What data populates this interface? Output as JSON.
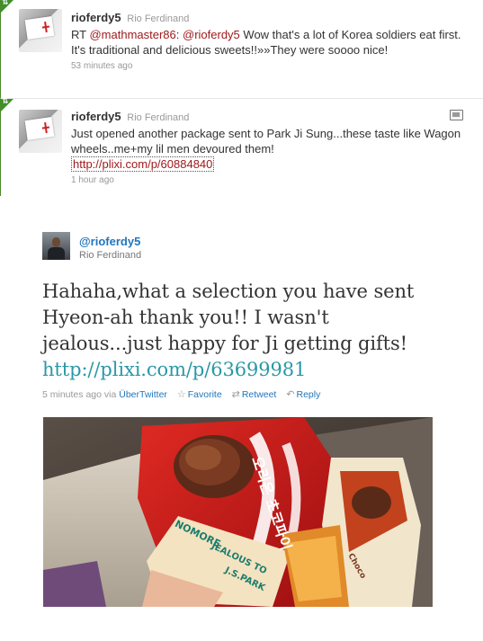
{
  "timeline": [
    {
      "screen_name": "rioferdy5",
      "display_name": "Rio Ferdinand",
      "text_before": "RT ",
      "mention_1": "@mathmaster86",
      "text_middle": ": ",
      "mention_2": "@rioferdy5",
      "text_after": " Wow that's a lot of Korea soldiers eat first. It's traditional and delicious sweets!!»»They were soooo nice!",
      "time": "53 minutes ago",
      "retweet_glyph": "⇅"
    },
    {
      "screen_name": "rioferdy5",
      "display_name": "Rio Ferdinand",
      "text": "Just opened another package sent to Park Ji Sung...these taste like Wagon wheels..me+my lil men devoured them!",
      "link": "http://plixi.com/p/60884840",
      "time": "1 hour ago",
      "retweet_glyph": "⇅"
    }
  ],
  "embedded_tweet": {
    "screen_name": "@rioferdy5",
    "display_name": "Rio Ferdinand",
    "text": "Hahaha,what a selection you have sent Hyeon-ah thank you!! I wasn't jealous...just happy for Ji getting gifts!",
    "link": "http://plixi.com/p/63699981",
    "time": "5 minutes ago",
    "via_label": "via",
    "source": "ÜberTwitter",
    "favorite_label": "Favorite",
    "retweet_label": "Retweet",
    "reply_label": "Reply"
  },
  "photo": {
    "box_text_main": "오리온 초코파이",
    "box_text_side": "Choco",
    "note_line_1": "NOMORE",
    "note_line_2": "JEALOUS TO",
    "note_line_3": "J.S.PARK"
  },
  "colors": {
    "retweet_green": "#3f8f2a",
    "link_red": "#a0191c",
    "link_blue": "#2276bb",
    "link_teal": "#2a98a6"
  }
}
